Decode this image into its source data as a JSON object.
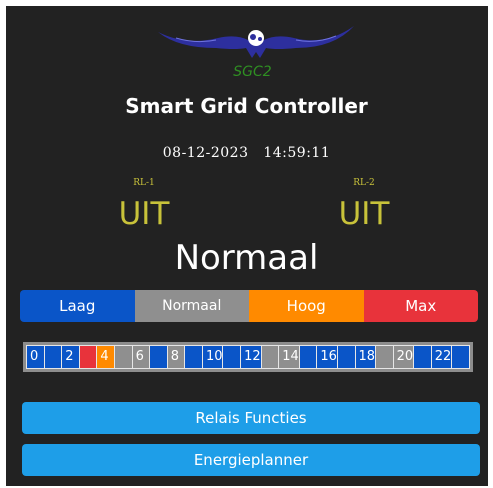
{
  "logo": {
    "text": "SGC2",
    "icon": "eagle-logo-icon"
  },
  "header": {
    "title": "Smart Grid Controller"
  },
  "clock": {
    "date": "08-12-2023",
    "time": "14:59:11"
  },
  "relays": [
    {
      "label": "RL-1",
      "state": "UIT"
    },
    {
      "label": "RL-2",
      "state": "UIT"
    }
  ],
  "mode": "Normaal",
  "levels": [
    {
      "label": "Laag",
      "color": "#0a55c8"
    },
    {
      "label": "Normaal",
      "color": "#8f8f8f"
    },
    {
      "label": "Hoog",
      "color": "#ff8a00"
    },
    {
      "label": "Max",
      "color": "#e8333b"
    }
  ],
  "hours": [
    {
      "label": "0",
      "color": "#0a55c8"
    },
    {
      "label": "",
      "color": "#0a55c8"
    },
    {
      "label": "2",
      "color": "#0a55c8"
    },
    {
      "label": "",
      "color": "#e8333b"
    },
    {
      "label": "4",
      "color": "#ff8a00"
    },
    {
      "label": "",
      "color": "#8f8f8f"
    },
    {
      "label": "6",
      "color": "#8f8f8f"
    },
    {
      "label": "",
      "color": "#0a55c8"
    },
    {
      "label": "8",
      "color": "#8f8f8f"
    },
    {
      "label": "",
      "color": "#0a55c8"
    },
    {
      "label": "10",
      "color": "#0a55c8"
    },
    {
      "label": "",
      "color": "#0a55c8"
    },
    {
      "label": "12",
      "color": "#0a55c8"
    },
    {
      "label": "",
      "color": "#8f8f8f"
    },
    {
      "label": "14",
      "color": "#8f8f8f"
    },
    {
      "label": "",
      "color": "#0a55c8"
    },
    {
      "label": "16",
      "color": "#0a55c8"
    },
    {
      "label": "",
      "color": "#0a55c8"
    },
    {
      "label": "18",
      "color": "#0a55c8"
    },
    {
      "label": "",
      "color": "#8f8f8f"
    },
    {
      "label": "20",
      "color": "#8f8f8f"
    },
    {
      "label": "",
      "color": "#0a55c8"
    },
    {
      "label": "22",
      "color": "#0a55c8"
    },
    {
      "label": "",
      "color": "#0a55c8"
    }
  ],
  "actions": {
    "relais_label": "Relais Functies",
    "planner_label": "Energieplanner"
  }
}
